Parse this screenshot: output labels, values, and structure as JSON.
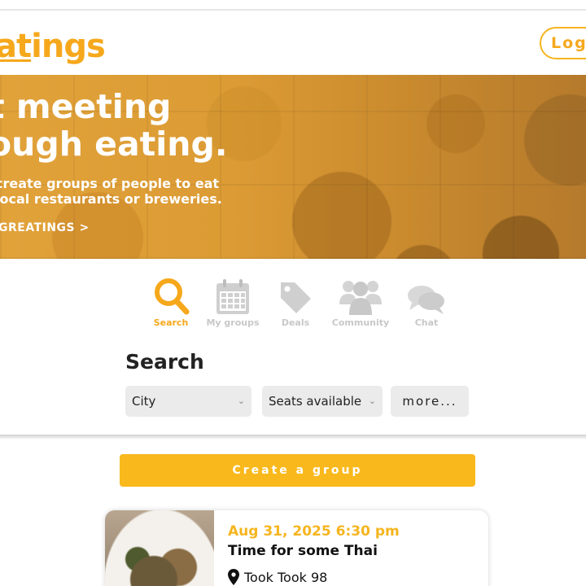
{
  "header": {
    "logo_text_underlined": "at",
    "logo_text_rest": "ings",
    "login_label": "Log"
  },
  "hero": {
    "title_line1": "t meeting",
    "title_line2": "ough eating.",
    "subtitle_line1": "create groups of people to eat",
    "subtitle_line2": "local restaurants or breweries.",
    "cta": "GREATINGS >"
  },
  "tabs": [
    {
      "label": "Search",
      "icon": "search-icon",
      "active": true
    },
    {
      "label": "My groups",
      "icon": "calendar-icon",
      "active": false
    },
    {
      "label": "Deals",
      "icon": "tag-icon",
      "active": false
    },
    {
      "label": "Community",
      "icon": "people-icon",
      "active": false
    },
    {
      "label": "Chat",
      "icon": "chat-icon",
      "active": false
    }
  ],
  "search": {
    "heading": "Search",
    "city_value": "City",
    "seats_value": "Seats available",
    "more_label": "more..."
  },
  "create_group_label": "Create a group",
  "card": {
    "date": "Aug 31, 2025 6:30 pm",
    "title": "Time for some Thai",
    "location": "Took Took 98"
  },
  "colors": {
    "accent": "#f6a81c",
    "button": "#f9b91c",
    "inactive_icon": "#cfcfcf"
  }
}
